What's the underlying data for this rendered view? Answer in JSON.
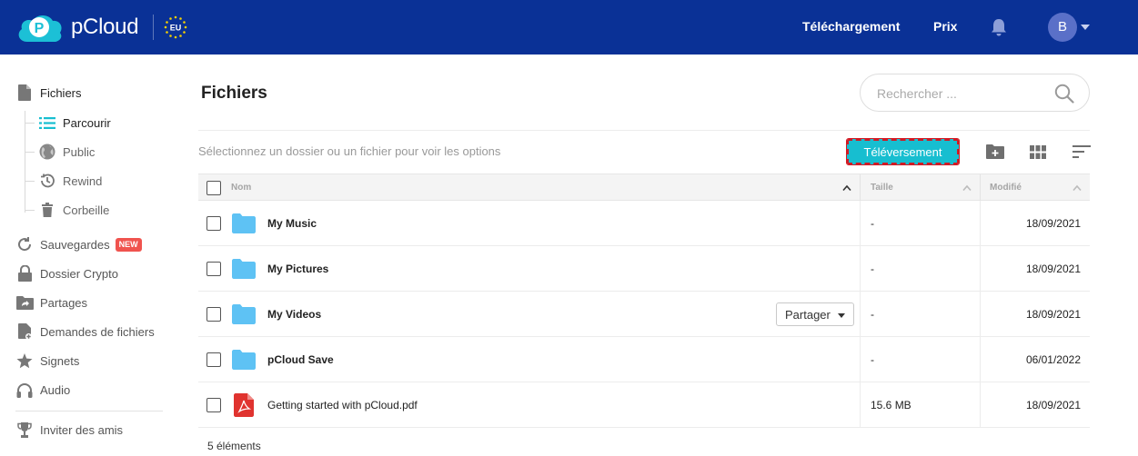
{
  "header": {
    "logo_text": "pCloud",
    "eu_label": "EU",
    "nav": {
      "download": "Téléchargement",
      "pricing": "Prix"
    },
    "avatar_initial": "B",
    "bg_color": "#0a3196"
  },
  "sidebar": {
    "files": "Fichiers",
    "browse": "Parcourir",
    "public": "Public",
    "rewind": "Rewind",
    "trash": "Corbeille",
    "backups": "Sauvegardes",
    "backups_badge": "NEW",
    "crypto": "Dossier Crypto",
    "shares": "Partages",
    "file_requests": "Demandes de fichiers",
    "bookmarks": "Signets",
    "audio": "Audio",
    "invite": "Inviter des amis"
  },
  "main": {
    "title": "Fichiers",
    "search_placeholder": "Rechercher ...",
    "hint": "Sélectionnez un dossier ou un fichier pour voir les options",
    "upload_label": "Téléversement",
    "accent_color": "#17bed0",
    "columns": {
      "name": "Nom",
      "size": "Taille",
      "modified": "Modifié"
    },
    "rows": [
      {
        "name": "My Music",
        "size": "-",
        "modified": "18/09/2021",
        "type": "folder"
      },
      {
        "name": "My Pictures",
        "size": "-",
        "modified": "18/09/2021",
        "type": "folder"
      },
      {
        "name": "My Videos",
        "size": "-",
        "modified": "18/09/2021",
        "type": "folder"
      },
      {
        "name": "pCloud Save",
        "size": "-",
        "modified": "06/01/2022",
        "type": "folder"
      },
      {
        "name": "Getting started with pCloud.pdf",
        "size": "15.6 MB",
        "modified": "18/09/2021",
        "type": "pdf"
      }
    ],
    "share_label": "Partager",
    "count": "5 éléments"
  }
}
